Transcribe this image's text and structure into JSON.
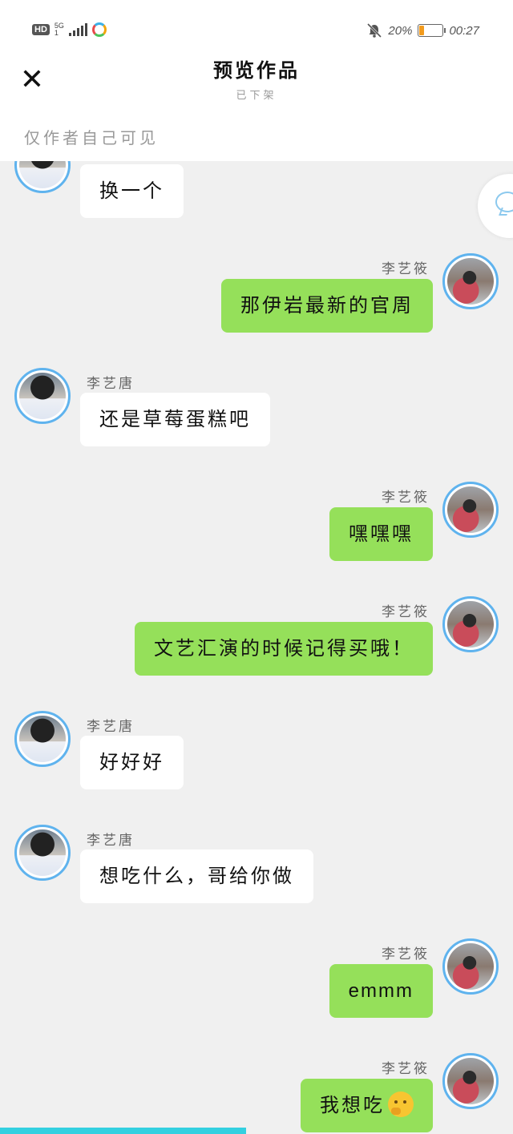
{
  "status_bar": {
    "hd": "HD",
    "network": "5G",
    "network_sub": "1",
    "battery_percent": "20%",
    "battery_level": 0.2,
    "time": "00:27"
  },
  "header": {
    "close_label": "✕",
    "title": "预览作品",
    "subtitle": "已下架",
    "visibility_note": "仅作者自己可见"
  },
  "colors": {
    "incoming_bubble": "#ffffff",
    "outgoing_bubble": "#95e05a",
    "avatar_ring": "#5fb3ee",
    "progress": "#33d0e0"
  },
  "messages": [
    {
      "side": "left",
      "sender": "",
      "text": "换一个"
    },
    {
      "side": "right",
      "sender": "李艺筱",
      "text": "那伊岩最新的官周"
    },
    {
      "side": "left",
      "sender": "李艺唐",
      "text": "还是草莓蛋糕吧"
    },
    {
      "side": "right",
      "sender": "李艺筱",
      "text": "嘿嘿嘿"
    },
    {
      "side": "right",
      "sender": "李艺筱",
      "text": "文艺汇演的时候记得买哦！"
    },
    {
      "side": "left",
      "sender": "李艺唐",
      "text": "好好好"
    },
    {
      "side": "left",
      "sender": "李艺唐",
      "text": "想吃什么，哥给你做"
    },
    {
      "side": "right",
      "sender": "李艺筱",
      "text": "emmm"
    },
    {
      "side": "right",
      "sender": "李艺筱",
      "text": "我想吃",
      "emoji": "thinking-face-icon"
    }
  ],
  "reading_progress": 0.48
}
